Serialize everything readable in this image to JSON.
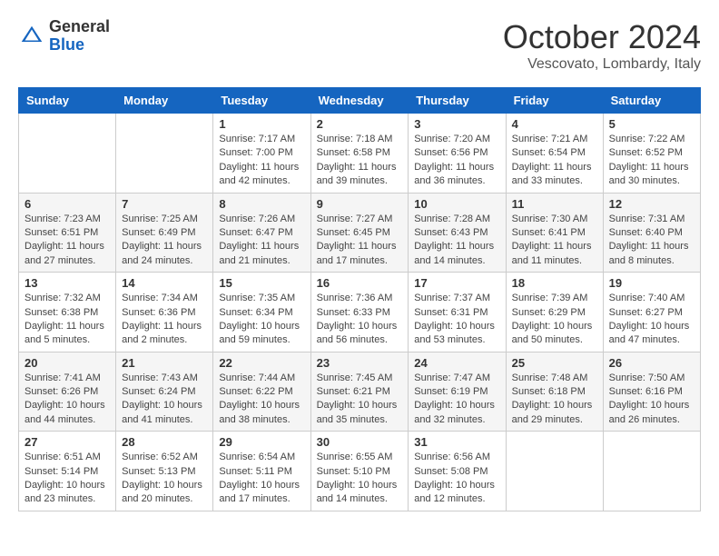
{
  "header": {
    "logo_general": "General",
    "logo_blue": "Blue",
    "month": "October 2024",
    "location": "Vescovato, Lombardy, Italy"
  },
  "days_of_week": [
    "Sunday",
    "Monday",
    "Tuesday",
    "Wednesday",
    "Thursday",
    "Friday",
    "Saturday"
  ],
  "weeks": [
    [
      {
        "day": "",
        "detail": ""
      },
      {
        "day": "",
        "detail": ""
      },
      {
        "day": "1",
        "detail": "Sunrise: 7:17 AM\nSunset: 7:00 PM\nDaylight: 11 hours and 42 minutes."
      },
      {
        "day": "2",
        "detail": "Sunrise: 7:18 AM\nSunset: 6:58 PM\nDaylight: 11 hours and 39 minutes."
      },
      {
        "day": "3",
        "detail": "Sunrise: 7:20 AM\nSunset: 6:56 PM\nDaylight: 11 hours and 36 minutes."
      },
      {
        "day": "4",
        "detail": "Sunrise: 7:21 AM\nSunset: 6:54 PM\nDaylight: 11 hours and 33 minutes."
      },
      {
        "day": "5",
        "detail": "Sunrise: 7:22 AM\nSunset: 6:52 PM\nDaylight: 11 hours and 30 minutes."
      }
    ],
    [
      {
        "day": "6",
        "detail": "Sunrise: 7:23 AM\nSunset: 6:51 PM\nDaylight: 11 hours and 27 minutes."
      },
      {
        "day": "7",
        "detail": "Sunrise: 7:25 AM\nSunset: 6:49 PM\nDaylight: 11 hours and 24 minutes."
      },
      {
        "day": "8",
        "detail": "Sunrise: 7:26 AM\nSunset: 6:47 PM\nDaylight: 11 hours and 21 minutes."
      },
      {
        "day": "9",
        "detail": "Sunrise: 7:27 AM\nSunset: 6:45 PM\nDaylight: 11 hours and 17 minutes."
      },
      {
        "day": "10",
        "detail": "Sunrise: 7:28 AM\nSunset: 6:43 PM\nDaylight: 11 hours and 14 minutes."
      },
      {
        "day": "11",
        "detail": "Sunrise: 7:30 AM\nSunset: 6:41 PM\nDaylight: 11 hours and 11 minutes."
      },
      {
        "day": "12",
        "detail": "Sunrise: 7:31 AM\nSunset: 6:40 PM\nDaylight: 11 hours and 8 minutes."
      }
    ],
    [
      {
        "day": "13",
        "detail": "Sunrise: 7:32 AM\nSunset: 6:38 PM\nDaylight: 11 hours and 5 minutes."
      },
      {
        "day": "14",
        "detail": "Sunrise: 7:34 AM\nSunset: 6:36 PM\nDaylight: 11 hours and 2 minutes."
      },
      {
        "day": "15",
        "detail": "Sunrise: 7:35 AM\nSunset: 6:34 PM\nDaylight: 10 hours and 59 minutes."
      },
      {
        "day": "16",
        "detail": "Sunrise: 7:36 AM\nSunset: 6:33 PM\nDaylight: 10 hours and 56 minutes."
      },
      {
        "day": "17",
        "detail": "Sunrise: 7:37 AM\nSunset: 6:31 PM\nDaylight: 10 hours and 53 minutes."
      },
      {
        "day": "18",
        "detail": "Sunrise: 7:39 AM\nSunset: 6:29 PM\nDaylight: 10 hours and 50 minutes."
      },
      {
        "day": "19",
        "detail": "Sunrise: 7:40 AM\nSunset: 6:27 PM\nDaylight: 10 hours and 47 minutes."
      }
    ],
    [
      {
        "day": "20",
        "detail": "Sunrise: 7:41 AM\nSunset: 6:26 PM\nDaylight: 10 hours and 44 minutes."
      },
      {
        "day": "21",
        "detail": "Sunrise: 7:43 AM\nSunset: 6:24 PM\nDaylight: 10 hours and 41 minutes."
      },
      {
        "day": "22",
        "detail": "Sunrise: 7:44 AM\nSunset: 6:22 PM\nDaylight: 10 hours and 38 minutes."
      },
      {
        "day": "23",
        "detail": "Sunrise: 7:45 AM\nSunset: 6:21 PM\nDaylight: 10 hours and 35 minutes."
      },
      {
        "day": "24",
        "detail": "Sunrise: 7:47 AM\nSunset: 6:19 PM\nDaylight: 10 hours and 32 minutes."
      },
      {
        "day": "25",
        "detail": "Sunrise: 7:48 AM\nSunset: 6:18 PM\nDaylight: 10 hours and 29 minutes."
      },
      {
        "day": "26",
        "detail": "Sunrise: 7:50 AM\nSunset: 6:16 PM\nDaylight: 10 hours and 26 minutes."
      }
    ],
    [
      {
        "day": "27",
        "detail": "Sunrise: 6:51 AM\nSunset: 5:14 PM\nDaylight: 10 hours and 23 minutes."
      },
      {
        "day": "28",
        "detail": "Sunrise: 6:52 AM\nSunset: 5:13 PM\nDaylight: 10 hours and 20 minutes."
      },
      {
        "day": "29",
        "detail": "Sunrise: 6:54 AM\nSunset: 5:11 PM\nDaylight: 10 hours and 17 minutes."
      },
      {
        "day": "30",
        "detail": "Sunrise: 6:55 AM\nSunset: 5:10 PM\nDaylight: 10 hours and 14 minutes."
      },
      {
        "day": "31",
        "detail": "Sunrise: 6:56 AM\nSunset: 5:08 PM\nDaylight: 10 hours and 12 minutes."
      },
      {
        "day": "",
        "detail": ""
      },
      {
        "day": "",
        "detail": ""
      }
    ]
  ]
}
